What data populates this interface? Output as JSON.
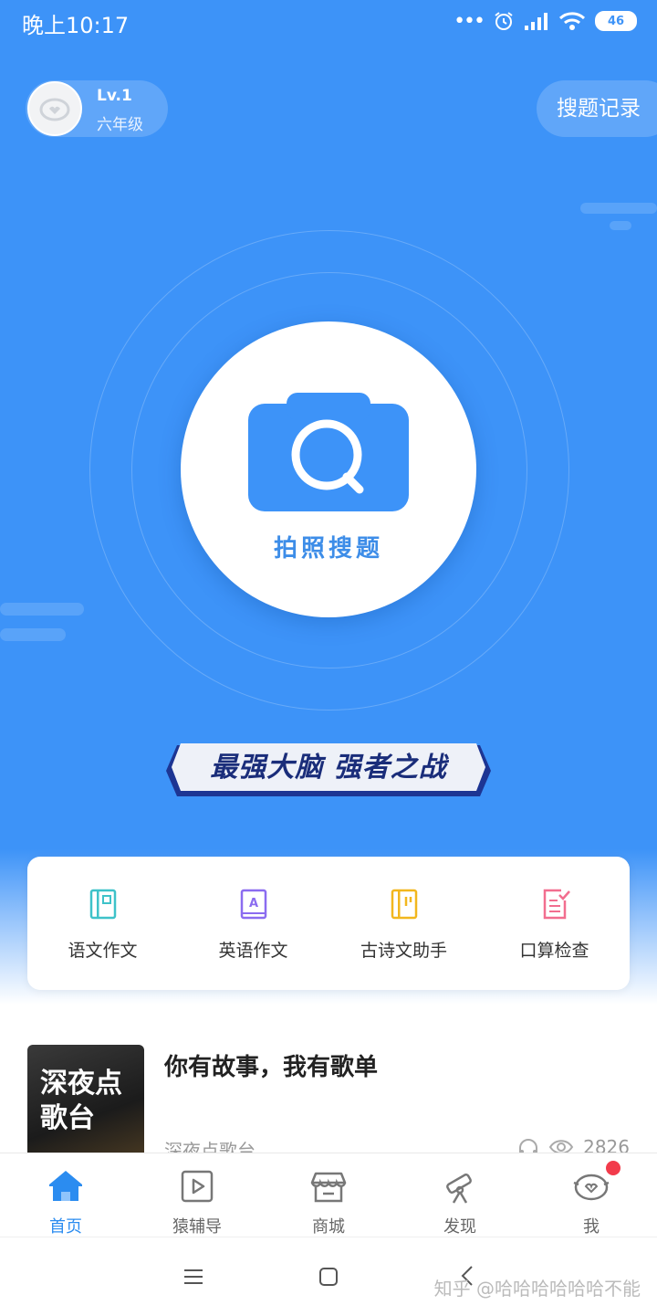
{
  "status_bar": {
    "time": "晚上10:17",
    "battery": "46"
  },
  "header": {
    "level": "Lv.1",
    "grade": "六年级",
    "history_button": "搜题记录"
  },
  "camera": {
    "label": "拍照搜题"
  },
  "banner": {
    "text": "最强大脑 强者之战"
  },
  "tools": [
    {
      "label": "语文作文",
      "icon": "book-icon",
      "color": "#3ec2c9"
    },
    {
      "label": "英语作文",
      "icon": "english-book-icon",
      "color": "#8b6cf0"
    },
    {
      "label": "古诗文助手",
      "icon": "poetry-book-icon",
      "color": "#f2b71e"
    },
    {
      "label": "口算检查",
      "icon": "checklist-icon",
      "color": "#f26e8f"
    }
  ],
  "article": {
    "thumb_text": "深夜点歌台",
    "title": "你有故事，我有歌单",
    "source": "深夜点歌台",
    "views": "2826"
  },
  "tabs": [
    {
      "label": "首页",
      "icon": "home-icon",
      "active": true
    },
    {
      "label": "猿辅导",
      "icon": "video-play-icon",
      "active": false
    },
    {
      "label": "商城",
      "icon": "store-icon",
      "active": false
    },
    {
      "label": "发现",
      "icon": "telescope-icon",
      "active": false
    },
    {
      "label": "我",
      "icon": "profile-icon",
      "active": false
    }
  ],
  "watermark": "知乎 @哈哈哈哈哈哈不能",
  "colors": {
    "primary_blue": "#3d93f8",
    "accent_blue": "#2b8cf0",
    "badge_red": "#f23b4b"
  }
}
